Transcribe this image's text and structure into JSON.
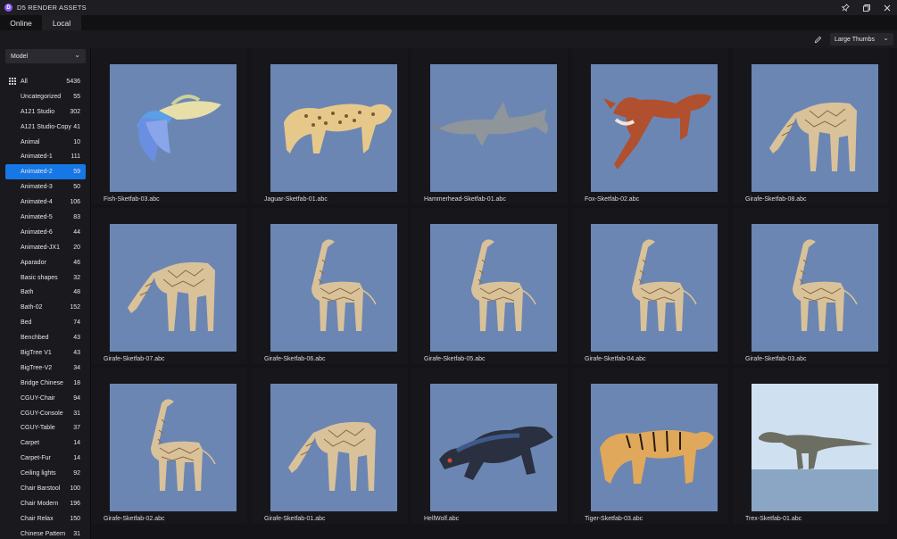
{
  "app": {
    "title": "D5 RENDER ASSETS",
    "logo": "D"
  },
  "window_controls": [
    "pin-icon",
    "restore-icon",
    "close-icon"
  ],
  "tabs": [
    {
      "label": "Online",
      "active": false
    },
    {
      "label": "Local",
      "active": true
    }
  ],
  "toolbar": {
    "view_mode": "Large Thumbs",
    "edit_icon": "pencil-icon"
  },
  "sidebar": {
    "category": "Model",
    "items": [
      {
        "label": "All",
        "count": "5436",
        "icon": "grid-icon"
      },
      {
        "label": "Uncategorized",
        "count": "55"
      },
      {
        "label": "A121 Studio",
        "count": "302"
      },
      {
        "label": "A121 Studio-Copy",
        "count": "41"
      },
      {
        "label": "Animal",
        "count": "10"
      },
      {
        "label": "Animated-1",
        "count": "111"
      },
      {
        "label": "Animated-2",
        "count": "59",
        "active": true
      },
      {
        "label": "Animated-3",
        "count": "50"
      },
      {
        "label": "Animated-4",
        "count": "106"
      },
      {
        "label": "Animated-5",
        "count": "83"
      },
      {
        "label": "Animated-6",
        "count": "44"
      },
      {
        "label": "Animated-JX1",
        "count": "20"
      },
      {
        "label": "Aparador",
        "count": "46"
      },
      {
        "label": "Basic shapes",
        "count": "32"
      },
      {
        "label": "Bath",
        "count": "48"
      },
      {
        "label": "Bath-02",
        "count": "152"
      },
      {
        "label": "Bed",
        "count": "74"
      },
      {
        "label": "Benchbed",
        "count": "43"
      },
      {
        "label": "BigTree V1",
        "count": "43"
      },
      {
        "label": "BigTree-V2",
        "count": "34"
      },
      {
        "label": "Bridge Chinese",
        "count": "18"
      },
      {
        "label": "CGUY-Chair",
        "count": "94"
      },
      {
        "label": "CGUY-Console",
        "count": "31"
      },
      {
        "label": "CGUY-Table",
        "count": "37"
      },
      {
        "label": "Carpet",
        "count": "14"
      },
      {
        "label": "Carpet-Fur",
        "count": "14"
      },
      {
        "label": "Ceiling lights",
        "count": "92"
      },
      {
        "label": "Chair Barstool",
        "count": "100"
      },
      {
        "label": "Chair Modern",
        "count": "196"
      },
      {
        "label": "Chair Relax",
        "count": "150"
      },
      {
        "label": "Chinese Pattern",
        "count": "31"
      }
    ]
  },
  "assets": [
    {
      "name": "Fish-Sketfab-03.abc",
      "kind": "fish"
    },
    {
      "name": "Jaguar-Sketfab-01.abc",
      "kind": "jaguar"
    },
    {
      "name": "Hammerhead-Sketfab-01.abc",
      "kind": "shark"
    },
    {
      "name": "Fox-Sketfab-02.abc",
      "kind": "fox"
    },
    {
      "name": "Girafe-Sketfab-08.abc",
      "kind": "giraffe-grazing"
    },
    {
      "name": "Girafe-Sketfab-07.abc",
      "kind": "giraffe-grazing"
    },
    {
      "name": "Girafe-Sketfab-06.abc",
      "kind": "giraffe"
    },
    {
      "name": "Girafe-Sketfab-05.abc",
      "kind": "giraffe"
    },
    {
      "name": "Girafe-Sketfab-04.abc",
      "kind": "giraffe"
    },
    {
      "name": "Girafe-Sketfab-03.abc",
      "kind": "giraffe"
    },
    {
      "name": "Girafe-Sketfab-02.abc",
      "kind": "giraffe"
    },
    {
      "name": "Girafe-Sketfab-01.abc",
      "kind": "giraffe-grazing"
    },
    {
      "name": "HellWolf.abc",
      "kind": "wolf"
    },
    {
      "name": "Tiger-Sketfab-03.abc",
      "kind": "tiger"
    },
    {
      "name": "Trex-Sketfab-01.abc",
      "kind": "trex"
    }
  ],
  "colors": {
    "accent": "#1677e6",
    "thumb_bg": "#6c86b3",
    "panel": "#1a1a1e",
    "background": "#141418"
  }
}
